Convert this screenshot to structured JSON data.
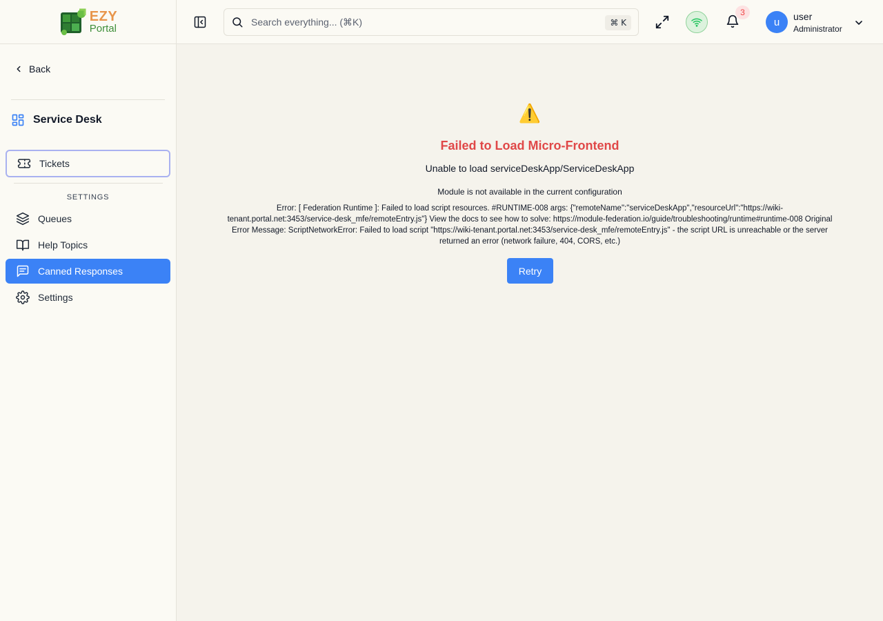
{
  "app": {
    "logo_top": "EZY",
    "logo_bottom": "Portal",
    "logo_icon": "puzzle-logo-icon"
  },
  "sidebar": {
    "back_label": "Back",
    "section_title": "Service Desk",
    "items": [
      {
        "label": "Tickets",
        "icon": "ticket-icon"
      },
      {
        "label": "Queues",
        "icon": "layers-icon"
      },
      {
        "label": "Help Topics",
        "icon": "book-icon"
      },
      {
        "label": "Canned Responses",
        "icon": "message-square-text-icon"
      },
      {
        "label": "Settings",
        "icon": "gear-icon"
      }
    ],
    "settings_label": "SETTINGS"
  },
  "header": {
    "search_placeholder": "Search everything... (⌘K)",
    "shortcut": "⌘ K",
    "notification_count": "3",
    "user_initial": "u",
    "user_name": "user",
    "user_role": "Administrator"
  },
  "error": {
    "icon": "⚠️",
    "title": "Failed to Load Micro-Frontend",
    "subtitle": "Unable to load serviceDeskApp/ServiceDeskApp",
    "detail": "Module is not available in the current configuration",
    "message": "Error: [ Federation Runtime ]: Failed to load script resources. #RUNTIME-008 args: {\"remoteName\":\"serviceDeskApp\",\"resourceUrl\":\"https://wiki-tenant.portal.net:3453/service-desk_mfe/remoteEntry.js\"} View the docs to see how to solve: https://module-federation.io/guide/troubleshooting/runtime#runtime-008 Original Error Message: ScriptNetworkError: Failed to load script \"https://wiki-tenant.portal.net:3453/service-desk_mfe/remoteEntry.js\" - the script URL is unreachable or the server returned an error (network failure, 404, CORS, etc.)",
    "retry_label": "Retry"
  },
  "colors": {
    "accent": "#3b82f6",
    "error": "#e04848",
    "online": "#22c55e"
  }
}
